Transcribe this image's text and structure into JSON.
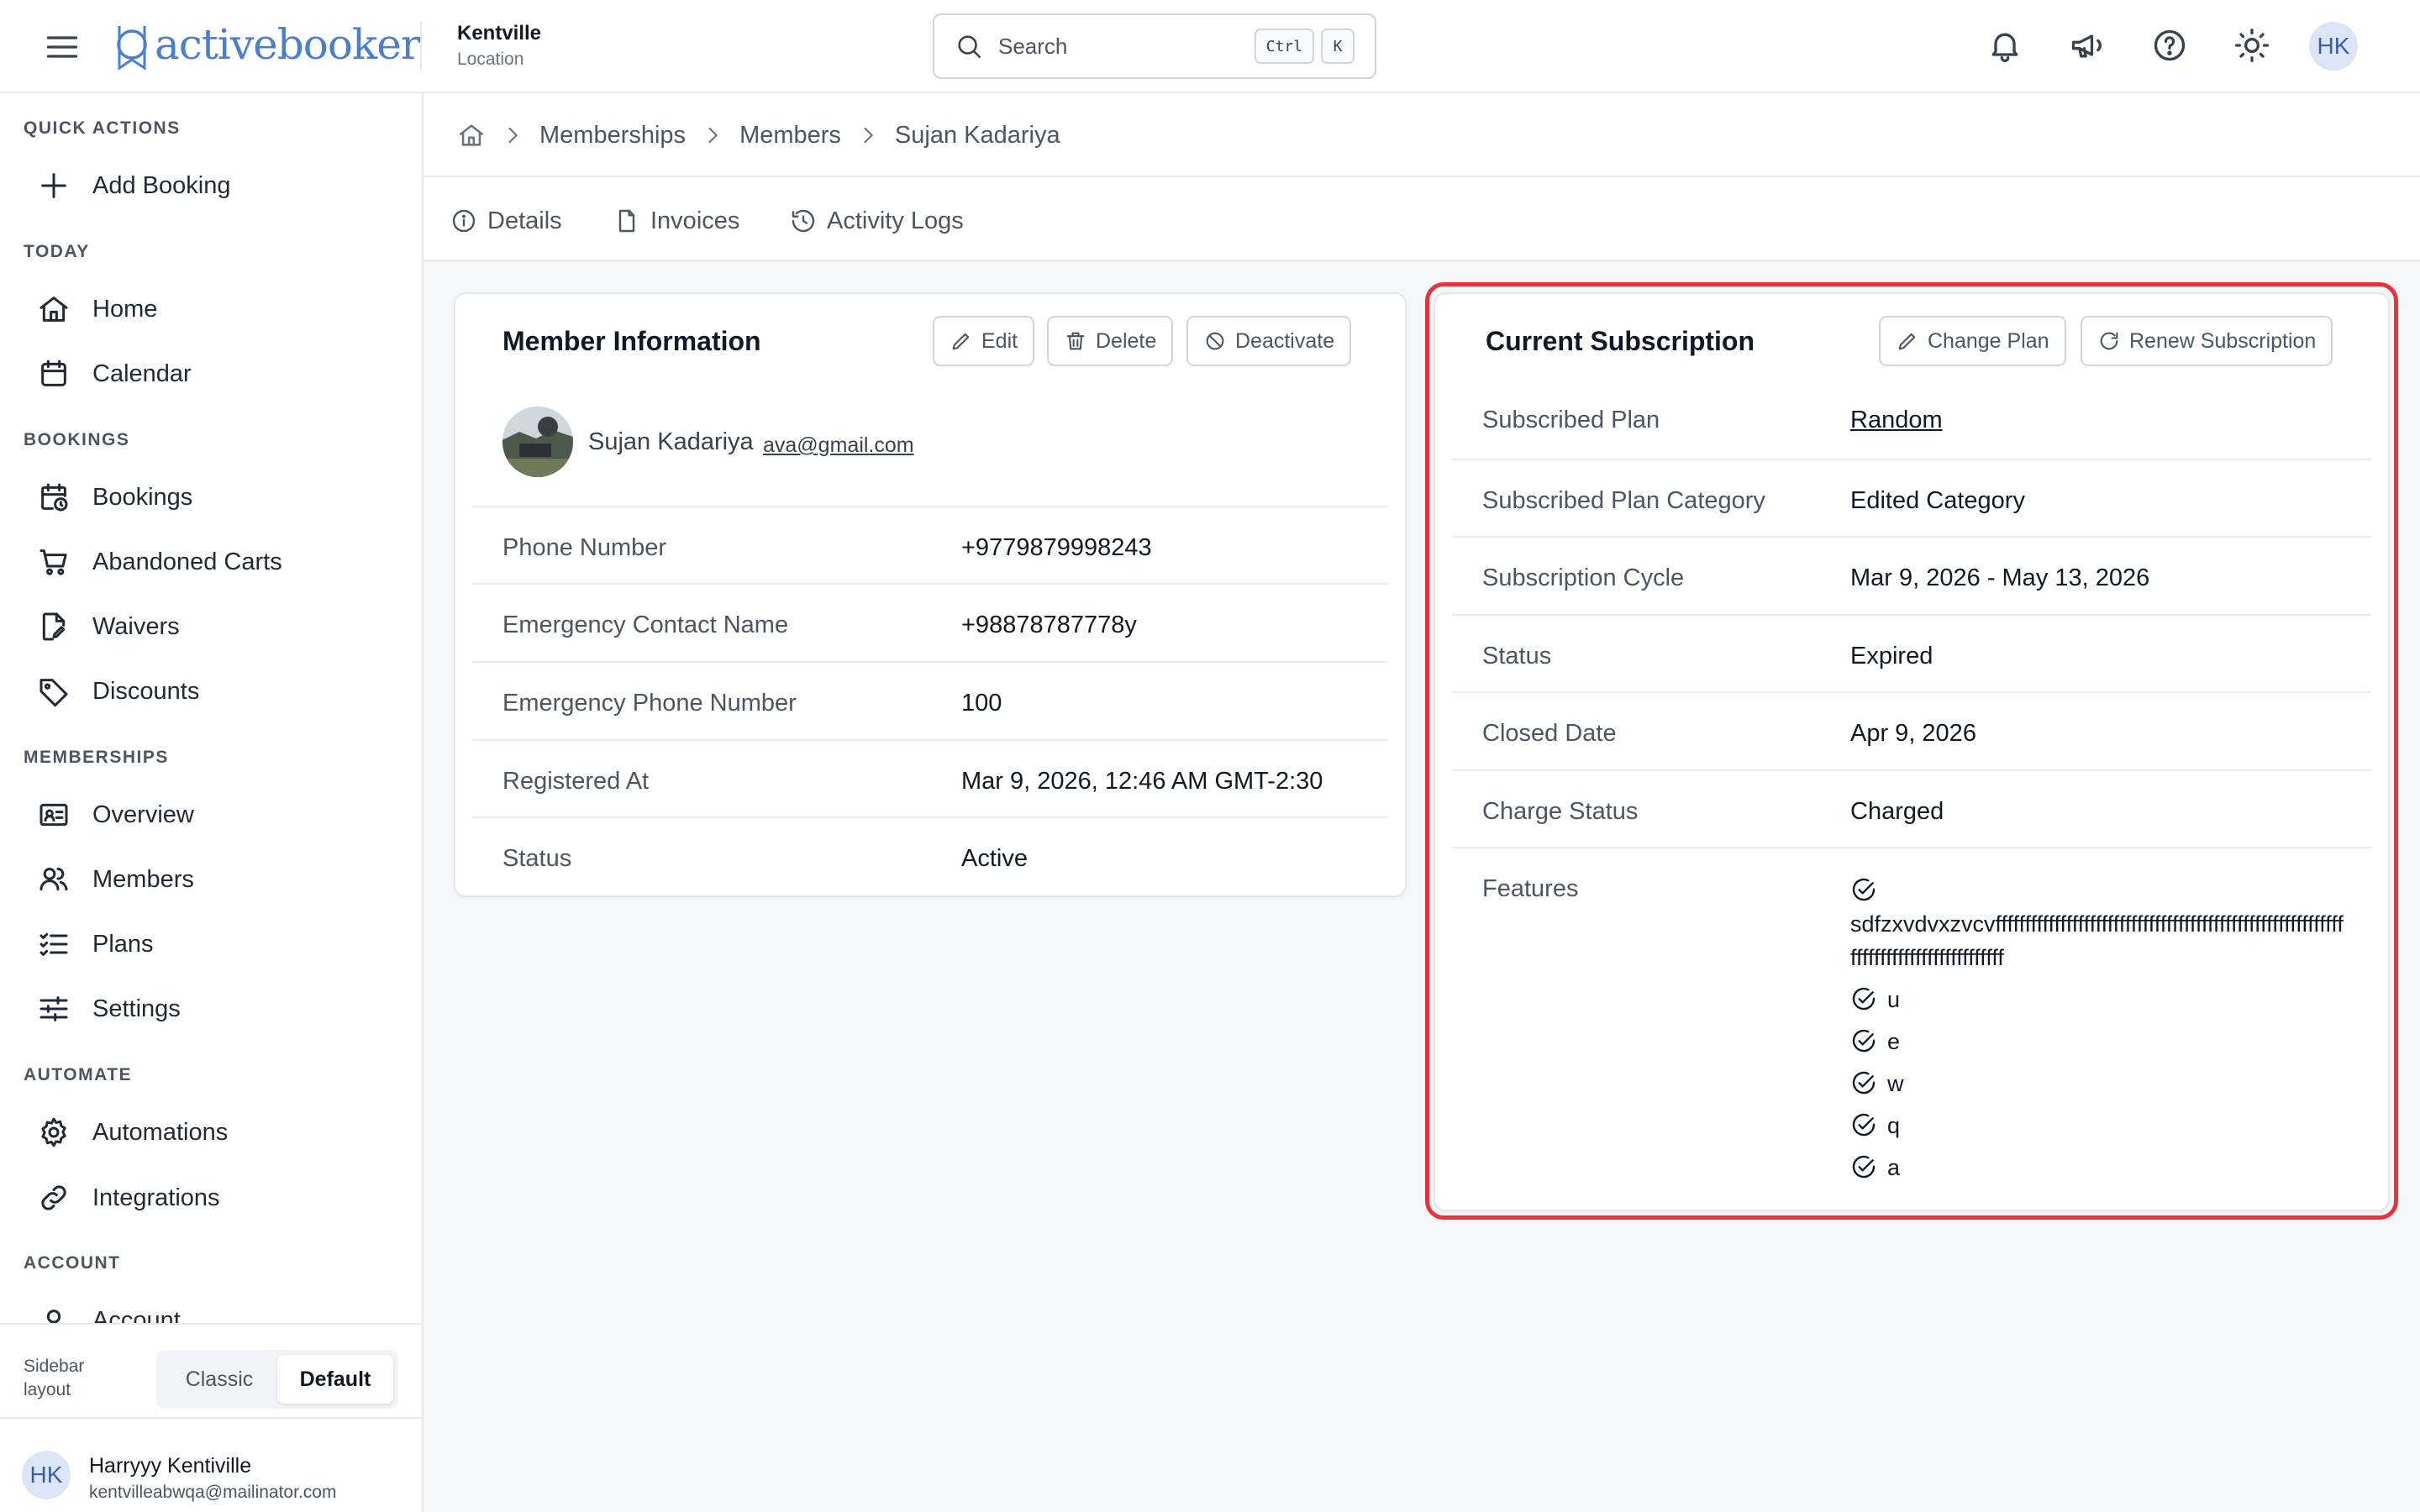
{
  "app": {
    "logo_text": "activebooker",
    "location_name": "Kentville",
    "location_label": "Location",
    "search_placeholder": "Search",
    "search_kbd_1": "Ctrl",
    "search_kbd_2": "K",
    "user_initials": "HK"
  },
  "sidebar": {
    "sections": [
      {
        "title": "QUICK ACTIONS",
        "items": [
          {
            "label": "Add Booking",
            "icon": "plus-icon"
          }
        ]
      },
      {
        "title": "TODAY",
        "items": [
          {
            "label": "Home",
            "icon": "home-icon"
          },
          {
            "label": "Calendar",
            "icon": "calendar-icon"
          }
        ]
      },
      {
        "title": "BOOKINGS",
        "items": [
          {
            "label": "Bookings",
            "icon": "calendar-clock-icon"
          },
          {
            "label": "Abandoned Carts",
            "icon": "cart-icon"
          },
          {
            "label": "Waivers",
            "icon": "document-edit-icon"
          },
          {
            "label": "Discounts",
            "icon": "tag-icon"
          }
        ]
      },
      {
        "title": "MEMBERSHIPS",
        "items": [
          {
            "label": "Overview",
            "icon": "id-card-icon"
          },
          {
            "label": "Members",
            "icon": "users-icon"
          },
          {
            "label": "Plans",
            "icon": "list-check-icon"
          },
          {
            "label": "Settings",
            "icon": "sliders-icon"
          }
        ]
      },
      {
        "title": "AUTOMATE",
        "items": [
          {
            "label": "Automations",
            "icon": "gear-icon"
          },
          {
            "label": "Integrations",
            "icon": "link-icon"
          }
        ]
      },
      {
        "title": "ACCOUNT",
        "items": [
          {
            "label": "Account",
            "icon": "user-icon"
          }
        ]
      }
    ],
    "layout_label": "Sidebar layout",
    "layout_options": [
      "Classic",
      "Default"
    ],
    "layout_selected": "Default",
    "user": {
      "initials": "HK",
      "name": "Harryyy Kentiville",
      "email": "kentvilleabwqa@mailinator.com"
    }
  },
  "breadcrumb": [
    "Memberships",
    "Members",
    "Sujan Kadariya"
  ],
  "tabs": [
    {
      "label": "Details",
      "icon": "info-icon"
    },
    {
      "label": "Invoices",
      "icon": "file-icon"
    },
    {
      "label": "Activity Logs",
      "icon": "history-icon"
    }
  ],
  "member_card": {
    "title": "Member Information",
    "buttons": {
      "edit": "Edit",
      "delete": "Delete",
      "deactivate": "Deactivate"
    },
    "name": "Sujan Kadariya",
    "email": "ava@gmail.com",
    "rows": [
      {
        "label": "Phone Number",
        "value": "+9779879998243"
      },
      {
        "label": "Emergency Contact Name",
        "value": "+98878787778y"
      },
      {
        "label": "Emergency Phone Number",
        "value": "100"
      },
      {
        "label": "Registered At",
        "value": "Mar 9, 2026, 12:46 AM GMT-2:30"
      },
      {
        "label": "Status",
        "value": "Active"
      }
    ]
  },
  "subscription_card": {
    "title": "Current Subscription",
    "buttons": {
      "change_plan": "Change Plan",
      "renew": "Renew Subscription"
    },
    "rows": [
      {
        "label": "Subscribed Plan",
        "value": "Random"
      },
      {
        "label": "Subscribed Plan Category",
        "value": "Edited Category"
      },
      {
        "label": "Subscription Cycle",
        "value": "Mar 9, 2026 - May 13, 2026"
      },
      {
        "label": "Status",
        "value": "Expired"
      },
      {
        "label": "Closed Date",
        "value": "Apr 9, 2026"
      },
      {
        "label": "Charge Status",
        "value": "Charged"
      }
    ],
    "features_label": "Features",
    "features": [
      "sdfzxvdvxzvcvfffffffffffffffffffffffffffffffffffffffffffffffffffffffffffffffffffffffffffffffffffff",
      "u",
      "e",
      "w",
      "q",
      "a"
    ]
  },
  "colors": {
    "accent": "#4a7fd0",
    "highlight": "#e8333d"
  }
}
